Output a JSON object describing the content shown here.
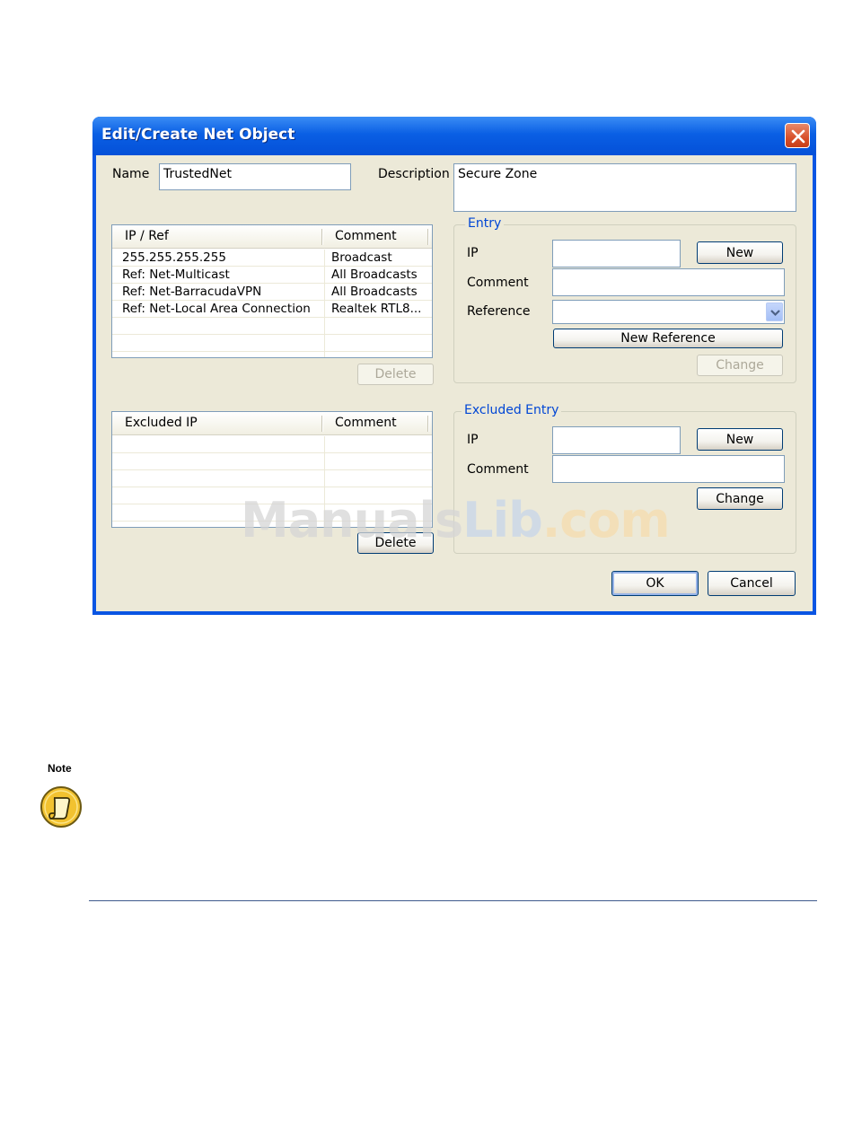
{
  "window": {
    "title": "Edit/Create Net Object"
  },
  "name": {
    "label": "Name",
    "value": "TrustedNet"
  },
  "description": {
    "label": "Description",
    "value": "Secure Zone"
  },
  "ip_list": {
    "headers": [
      "IP / Ref",
      "Comment"
    ],
    "rows": [
      {
        "ip": "255.255.255.255",
        "comment": "Broadcast"
      },
      {
        "ip": "Ref: Net-Multicast",
        "comment": "All Broadcasts"
      },
      {
        "ip": "Ref: Net-BarracudaVPN",
        "comment": "All Broadcasts"
      },
      {
        "ip": "Ref: Net-Local Area Connection",
        "comment": "Realtek RTL8..."
      }
    ],
    "delete_label": "Delete"
  },
  "excluded_list": {
    "headers": [
      "Excluded IP",
      "Comment"
    ],
    "rows": [],
    "delete_label": "Delete"
  },
  "entry": {
    "title": "Entry",
    "ip_label": "IP",
    "ip_value": "",
    "comment_label": "Comment",
    "comment_value": "",
    "reference_label": "Reference",
    "reference_value": "",
    "new_label": "New",
    "new_reference_label": "New Reference",
    "change_label": "Change"
  },
  "excluded_entry": {
    "title": "Excluded Entry",
    "ip_label": "IP",
    "ip_value": "",
    "comment_label": "Comment",
    "comment_value": "",
    "new_label": "New",
    "change_label": "Change"
  },
  "buttons": {
    "ok": "OK",
    "cancel": "Cancel"
  },
  "watermark": {
    "part1": "Manuals",
    "part2": "Lib",
    "part3": ".com"
  },
  "note": {
    "label": "Note",
    "icon": "note-icon"
  },
  "colors": {
    "titlebar": "#0a5fe4",
    "dialog_bg": "#ece9d8",
    "group_title": "#0046d5"
  }
}
